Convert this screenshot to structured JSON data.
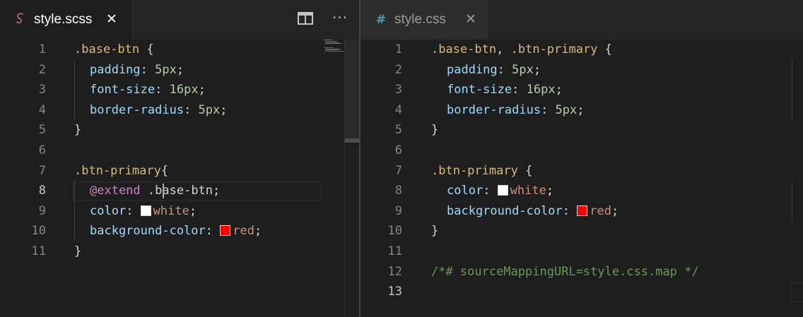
{
  "left_editor": {
    "tab": {
      "icon": "sass-icon",
      "label": "style.scss",
      "close_glyph": "✕"
    },
    "toolbar": {
      "split_icon": "split-editor-icon",
      "more_glyph": "···"
    },
    "lines": [
      {
        "num": "1",
        "tokens": [
          {
            "t": ".base-btn",
            "c": "selector"
          },
          {
            "t": " {",
            "c": "punct"
          }
        ]
      },
      {
        "num": "2",
        "indent": 1,
        "tokens": [
          {
            "t": "padding",
            "c": "prop"
          },
          {
            "t": ": ",
            "c": "punct"
          },
          {
            "t": "5px",
            "c": "num"
          },
          {
            "t": ";",
            "c": "punct"
          }
        ]
      },
      {
        "num": "3",
        "indent": 1,
        "tokens": [
          {
            "t": "font-size",
            "c": "prop"
          },
          {
            "t": ": ",
            "c": "punct"
          },
          {
            "t": "16px",
            "c": "num"
          },
          {
            "t": ";",
            "c": "punct"
          }
        ]
      },
      {
        "num": "4",
        "indent": 1,
        "tokens": [
          {
            "t": "border-radius",
            "c": "prop"
          },
          {
            "t": ": ",
            "c": "punct"
          },
          {
            "t": "5px",
            "c": "num"
          },
          {
            "t": ";",
            "c": "punct"
          }
        ]
      },
      {
        "num": "5",
        "tokens": [
          {
            "t": "}",
            "c": "punct"
          }
        ]
      },
      {
        "num": "6",
        "tokens": []
      },
      {
        "num": "7",
        "tokens": [
          {
            "t": ".btn-primary",
            "c": "selector"
          },
          {
            "t": "{",
            "c": "punct"
          }
        ]
      },
      {
        "num": "8",
        "indent": 1,
        "active": true,
        "tokens": [
          {
            "t": "@extend",
            "c": "kw"
          },
          {
            "t": " .",
            "c": "punct"
          },
          {
            "t": "base-btn",
            "c": "punct"
          },
          {
            "t": ";",
            "c": "punct"
          }
        ]
      },
      {
        "num": "9",
        "indent": 1,
        "tokens": [
          {
            "t": "color",
            "c": "prop"
          },
          {
            "t": ": ",
            "c": "punct"
          },
          {
            "swatch": "#ffffff"
          },
          {
            "t": "white",
            "c": "str"
          },
          {
            "t": ";",
            "c": "punct"
          }
        ]
      },
      {
        "num": "10",
        "indent": 1,
        "tokens": [
          {
            "t": "background-color",
            "c": "prop"
          },
          {
            "t": ": ",
            "c": "punct"
          },
          {
            "swatch": "#ff0000"
          },
          {
            "t": "red",
            "c": "str"
          },
          {
            "t": ";",
            "c": "punct"
          }
        ]
      },
      {
        "num": "11",
        "tokens": [
          {
            "t": "}",
            "c": "punct"
          }
        ]
      }
    ]
  },
  "right_editor": {
    "tab": {
      "icon": "hash-icon",
      "icon_glyph": "#",
      "label": "style.css",
      "close_glyph": "✕"
    },
    "lines": [
      {
        "num": "1",
        "tokens": [
          {
            "t": ".base-btn",
            "c": "selector"
          },
          {
            "t": ", ",
            "c": "punct"
          },
          {
            "t": ".btn-primary",
            "c": "selector"
          },
          {
            "t": " {",
            "c": "punct"
          }
        ]
      },
      {
        "num": "2",
        "indent": 1,
        "tokens": [
          {
            "t": "padding",
            "c": "prop"
          },
          {
            "t": ": ",
            "c": "punct"
          },
          {
            "t": "5px",
            "c": "num"
          },
          {
            "t": ";",
            "c": "punct"
          }
        ]
      },
      {
        "num": "3",
        "indent": 1,
        "tokens": [
          {
            "t": "font-size",
            "c": "prop"
          },
          {
            "t": ": ",
            "c": "punct"
          },
          {
            "t": "16px",
            "c": "num"
          },
          {
            "t": ";",
            "c": "punct"
          }
        ]
      },
      {
        "num": "4",
        "indent": 1,
        "tokens": [
          {
            "t": "border-radius",
            "c": "prop"
          },
          {
            "t": ": ",
            "c": "punct"
          },
          {
            "t": "5px",
            "c": "num"
          },
          {
            "t": ";",
            "c": "punct"
          }
        ]
      },
      {
        "num": "5",
        "tokens": [
          {
            "t": "}",
            "c": "punct"
          }
        ]
      },
      {
        "num": "6",
        "tokens": []
      },
      {
        "num": "7",
        "tokens": [
          {
            "t": ".btn-primary",
            "c": "selector"
          },
          {
            "t": " {",
            "c": "punct"
          }
        ]
      },
      {
        "num": "8",
        "indent": 1,
        "tokens": [
          {
            "t": "color",
            "c": "prop"
          },
          {
            "t": ": ",
            "c": "punct"
          },
          {
            "swatch": "#ffffff"
          },
          {
            "t": "white",
            "c": "str"
          },
          {
            "t": ";",
            "c": "punct"
          }
        ]
      },
      {
        "num": "9",
        "indent": 1,
        "tokens": [
          {
            "t": "background-color",
            "c": "prop"
          },
          {
            "t": ": ",
            "c": "punct"
          },
          {
            "swatch": "#ff0000"
          },
          {
            "t": "red",
            "c": "str"
          },
          {
            "t": ";",
            "c": "punct"
          }
        ]
      },
      {
        "num": "10",
        "tokens": [
          {
            "t": "}",
            "c": "punct"
          }
        ]
      },
      {
        "num": "11",
        "tokens": []
      },
      {
        "num": "12",
        "tokens": [
          {
            "t": "/*# sourceMappingURL=style.css.map */",
            "c": "comment"
          }
        ]
      },
      {
        "num": "13",
        "active": true,
        "tokens": []
      }
    ]
  },
  "colors": {
    "sass_pink": "#cd6799",
    "css_blue": "#519aba"
  }
}
